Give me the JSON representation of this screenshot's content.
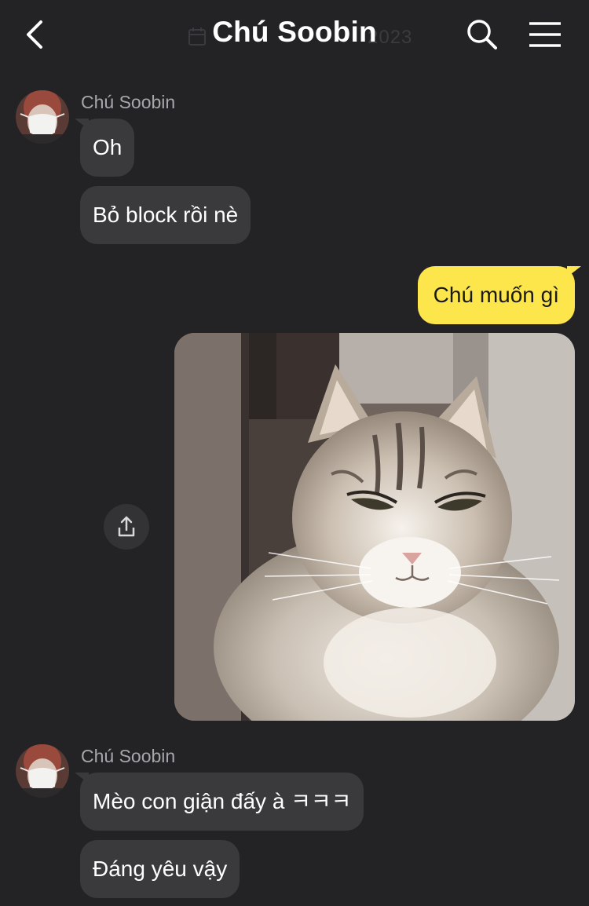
{
  "header": {
    "title": "Chú Soobin",
    "date_ghost": "2023"
  },
  "messages": {
    "group1": {
      "sender": "Chú Soobin",
      "bubble1": "Oh",
      "bubble2": "Bỏ block rồi nè"
    },
    "mine1": "Chú muốn gì",
    "group2": {
      "sender": "Chú Soobin",
      "bubble1": "Mèo con giận đấy à ㅋㅋㅋ",
      "bubble2": "Đáng yêu vậy"
    }
  },
  "colors": {
    "background": "#232326",
    "incoming_bubble": "#3a3a3d",
    "outgoing_bubble": "#fde64b"
  },
  "icons": [
    "back-icon",
    "calendar-icon",
    "search-icon",
    "menu-icon",
    "share-icon"
  ]
}
